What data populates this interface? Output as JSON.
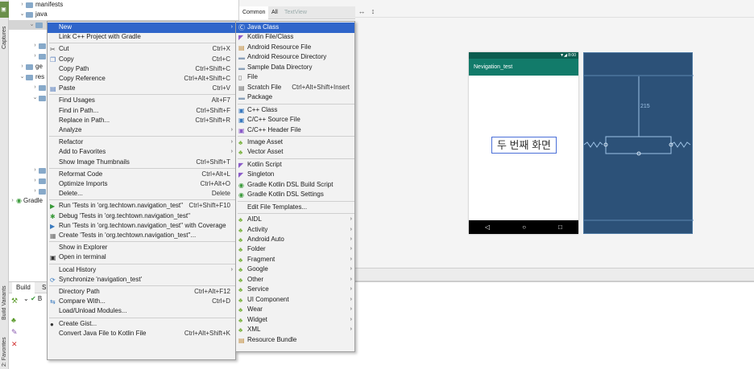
{
  "left_strip": {
    "captures": "Captures",
    "build_variants": "Build Variants",
    "favorites": "2: Favorites"
  },
  "tree": {
    "manifests": "manifests",
    "java": "java",
    "gen_fragment": "ge",
    "res_fragment": "res",
    "gradle_fragment": "Gradle"
  },
  "build_panel": {
    "tab_build": "Build",
    "tab_fragment": "S",
    "row_fragment": "B"
  },
  "editor": {
    "palette_tab_common": "Common",
    "palette_tab_all": "All",
    "palette_tab_textview": "TextView",
    "phone_status": "▼◢ 8:00",
    "phone_appbar_title": "Nevigation_test",
    "phone_center_text": "두 번째 화면",
    "nav_back": "◁",
    "nav_home": "○",
    "nav_recent": "□",
    "blueprint_margin": "215"
  },
  "main_menu": {
    "items": [
      {
        "label": "New",
        "shortcut": "",
        "submenu": true,
        "icon": ""
      },
      {
        "label": "Link C++ Project with Gradle",
        "shortcut": "",
        "icon": ""
      },
      {
        "label": "Cut",
        "shortcut": "Ctrl+X",
        "icon": "scissors-icon"
      },
      {
        "label": "Copy",
        "shortcut": "Ctrl+C",
        "icon": "copy-icon"
      },
      {
        "label": "Copy Path",
        "shortcut": "Ctrl+Shift+C",
        "icon": ""
      },
      {
        "label": "Copy Reference",
        "shortcut": "Ctrl+Alt+Shift+C",
        "icon": ""
      },
      {
        "label": "Paste",
        "shortcut": "Ctrl+V",
        "icon": "paste-icon"
      },
      {
        "label": "Find Usages",
        "shortcut": "Alt+F7",
        "icon": ""
      },
      {
        "label": "Find in Path...",
        "shortcut": "Ctrl+Shift+F",
        "icon": ""
      },
      {
        "label": "Replace in Path...",
        "shortcut": "Ctrl+Shift+R",
        "icon": ""
      },
      {
        "label": "Analyze",
        "shortcut": "",
        "submenu": true,
        "icon": ""
      },
      {
        "label": "Refactor",
        "shortcut": "",
        "submenu": true,
        "icon": ""
      },
      {
        "label": "Add to Favorites",
        "shortcut": "",
        "submenu": true,
        "icon": ""
      },
      {
        "label": "Show Image Thumbnails",
        "shortcut": "Ctrl+Shift+T",
        "icon": ""
      },
      {
        "label": "Reformat Code",
        "shortcut": "Ctrl+Alt+L",
        "icon": ""
      },
      {
        "label": "Optimize Imports",
        "shortcut": "Ctrl+Alt+O",
        "icon": ""
      },
      {
        "label": "Delete...",
        "shortcut": "Delete",
        "icon": ""
      },
      {
        "label": "Run 'Tests in 'org.techtown.navigation_test''",
        "shortcut": "Ctrl+Shift+F10",
        "icon": "run-icon"
      },
      {
        "label": "Debug 'Tests in 'org.techtown.navigation_test''",
        "shortcut": "",
        "icon": "debug-icon"
      },
      {
        "label": "Run 'Tests in 'org.techtown.navigation_test'' with Coverage",
        "shortcut": "",
        "icon": "coverage-icon"
      },
      {
        "label": "Create 'Tests in 'org.techtown.navigation_test''...",
        "shortcut": "",
        "icon": "create-test-icon"
      },
      {
        "label": "Show in Explorer",
        "shortcut": "",
        "icon": ""
      },
      {
        "label": "Open in terminal",
        "shortcut": "",
        "icon": "terminal-icon"
      },
      {
        "label": "Local History",
        "shortcut": "",
        "submenu": true,
        "icon": ""
      },
      {
        "label": "Synchronize 'navigation_test'",
        "shortcut": "",
        "icon": "sync-icon"
      },
      {
        "label": "Directory Path",
        "shortcut": "Ctrl+Alt+F12",
        "icon": ""
      },
      {
        "label": "Compare With...",
        "shortcut": "Ctrl+D",
        "icon": "compare-icon"
      },
      {
        "label": "Load/Unload Modules...",
        "shortcut": "",
        "icon": ""
      },
      {
        "label": "Create Gist...",
        "shortcut": "",
        "icon": "github-icon"
      },
      {
        "label": "Convert Java File to Kotlin File",
        "shortcut": "Ctrl+Alt+Shift+K",
        "icon": ""
      }
    ]
  },
  "new_menu": {
    "items": [
      {
        "label": "Java Class",
        "shortcut": "",
        "icon": "java-class-icon"
      },
      {
        "label": "Kotlin File/Class",
        "shortcut": "",
        "icon": "kotlin-icon"
      },
      {
        "label": "Android Resource File",
        "shortcut": "",
        "icon": "resource-file-icon"
      },
      {
        "label": "Android Resource Directory",
        "shortcut": "",
        "icon": "folder-icon"
      },
      {
        "label": "Sample Data Directory",
        "shortcut": "",
        "icon": "folder-icon"
      },
      {
        "label": "File",
        "shortcut": "",
        "icon": "file-icon"
      },
      {
        "label": "Scratch File",
        "shortcut": "Ctrl+Alt+Shift+Insert",
        "icon": "scratch-icon"
      },
      {
        "label": "Package",
        "shortcut": "",
        "icon": "package-icon"
      },
      {
        "label": "C++ Class",
        "shortcut": "",
        "icon": "cpp-icon"
      },
      {
        "label": "C/C++ Source File",
        "shortcut": "",
        "icon": "c-source-icon"
      },
      {
        "label": "C/C++ Header File",
        "shortcut": "",
        "icon": "c-header-icon"
      },
      {
        "label": "Image Asset",
        "shortcut": "",
        "icon": "android-icon"
      },
      {
        "label": "Vector Asset",
        "shortcut": "",
        "icon": "android-icon"
      },
      {
        "label": "Kotlin Script",
        "shortcut": "",
        "icon": "kotlin-icon"
      },
      {
        "label": "Singleton",
        "shortcut": "",
        "icon": "singleton-icon"
      },
      {
        "label": "Gradle Kotlin DSL Build Script",
        "shortcut": "",
        "icon": "gradle-icon"
      },
      {
        "label": "Gradle Kotlin DSL Settings",
        "shortcut": "",
        "icon": "gradle-icon"
      },
      {
        "label": "Edit File Templates...",
        "shortcut": "",
        "icon": ""
      },
      {
        "label": "AIDL",
        "submenu": true,
        "icon": "android-icon"
      },
      {
        "label": "Activity",
        "submenu": true,
        "icon": "android-icon"
      },
      {
        "label": "Android Auto",
        "submenu": true,
        "icon": "android-icon"
      },
      {
        "label": "Folder",
        "submenu": true,
        "icon": "android-icon"
      },
      {
        "label": "Fragment",
        "submenu": true,
        "icon": "android-icon"
      },
      {
        "label": "Google",
        "submenu": true,
        "icon": "android-icon"
      },
      {
        "label": "Other",
        "submenu": true,
        "icon": "android-icon"
      },
      {
        "label": "Service",
        "submenu": true,
        "icon": "android-icon"
      },
      {
        "label": "UI Component",
        "submenu": true,
        "icon": "android-icon"
      },
      {
        "label": "Wear",
        "submenu": true,
        "icon": "android-icon"
      },
      {
        "label": "Widget",
        "submenu": true,
        "icon": "android-icon"
      },
      {
        "label": "XML",
        "submenu": true,
        "icon": "android-icon"
      },
      {
        "label": "Resource Bundle",
        "icon": "resource-bundle-icon"
      }
    ]
  },
  "colors": {
    "highlight": "#2f65ca",
    "phone_appbar": "#127b6a",
    "blueprint": "#2c5178"
  }
}
